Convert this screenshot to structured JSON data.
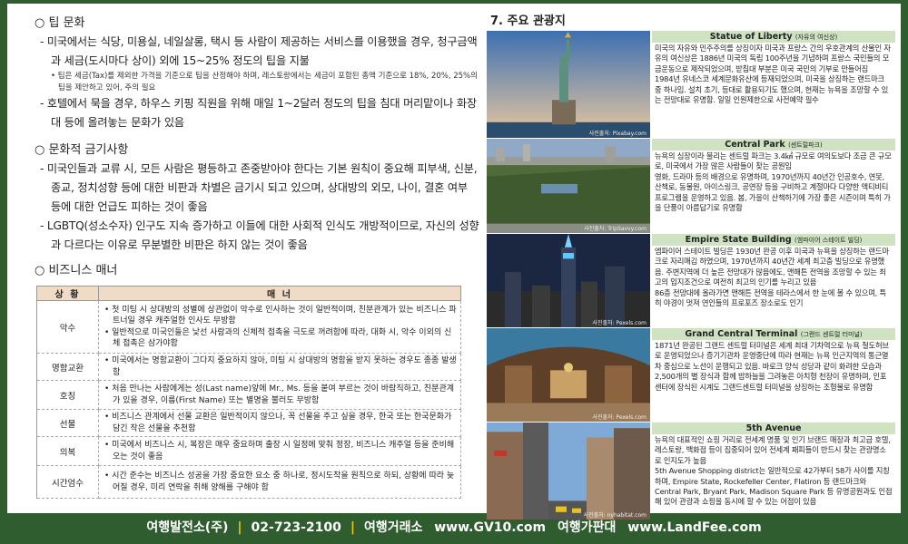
{
  "left": {
    "tip": {
      "heading": "○ 팁 문화",
      "p1": "- 미국에서는 식당, 미용실, 네일살롱, 택시 등 사람이 제공하는 서비스를 이용했을 경우, 청구금액과 세금(도시마다 상이) 외에 15~25% 정도의 팁을 지불",
      "note": "• 팁은 세금(Tax)를 제외한 가격을 기준으로 팁을 산정해야 하며, 레스토랑에서는 세금이 포함된 총액 기준으로 18%, 20%, 25%의 팁을 제안하고 있어, 주의 필요",
      "p2": "- 호텔에서 묵을 경우, 하우스 키핑 직원을 위해 매일 1~2달러 정도의 팁을 침대 머리맡이나 화장대 등에 올려놓는 문화가 있음"
    },
    "taboo": {
      "heading": "○ 문화적 금기사항",
      "p1": "- 미국인들과 교류 시, 모든 사람은 평등하고 존중받아야 한다는 기본 원칙이 중요해 피부색, 신분, 종교, 정치성향 등에 대한 비판과 차별은 금기시 되고 있으며, 상대방의 외모, 나이, 결혼 여부 등에 대한 언급도 피하는 것이 좋음",
      "p2": "- LGBTQ(성소수자) 인구도 지속 증가하고 이들에 대한 사회적 인식도 개방적이므로, 자신의 성향과 다르다는 이유로 무분별한 비판은 하지 않는 것이 좋음"
    },
    "manner": {
      "heading": "○ 비즈니스 매너",
      "col1": "상 황",
      "col2": "매 너",
      "rows": [
        {
          "cat": "악수",
          "items": [
            "첫 미팅 시 상대방의 성별에 상관없이 악수로 인사하는 것이 일반적이며, 친분관계가 있는 비즈니스 파트너일 경우 캐주얼한 인사도 무방함",
            "일반적으로 미국인들은 낯선 사람과의 신체적 접촉을 극도로 꺼려함에 따라, 대화 시, 악수 이외의 신체 접촉은 삼가야함"
          ]
        },
        {
          "cat": "명함교환",
          "items": [
            "미국에서는 명함교환이 그다지 중요하지 않아, 미팅 시 상대방의 명함을 받지 못하는 경우도 종종 발생함"
          ]
        },
        {
          "cat": "호칭",
          "items": [
            "처음 만나는 사람에게는 성(Last name)앞에 Mr., Ms. 등을 붙여 부르는 것이 바람직하고, 친분관계가 있을 경우, 이름(First Name) 또는 별명을 불러도 무방함"
          ]
        },
        {
          "cat": "선물",
          "items": [
            "비즈니스 관계에서 선물 교환은 일반적이지 않으나, 꼭 선물을 주고 싶을 경우, 한국 또는 한국문화가 담긴 작은 선물을 추천함"
          ]
        },
        {
          "cat": "의복",
          "items": [
            "미국에서 비즈니스 시, 복장은 매우 중요하며 출장 시 일정에 맞춰 정장, 비즈니스 캐주얼 등을 준비해오는 것이 좋음"
          ]
        },
        {
          "cat": "시간엄수",
          "items": [
            "시간 준수는 비즈니스 성공을 가장 중요한 요소 중 하나로, 정시도착을 원칙으로 하되, 상황에 따라 늦어질 경우, 미리 연락을 취해 양해를 구해야 함"
          ]
        }
      ]
    }
  },
  "right": {
    "title": "7. 주요 관광지",
    "attractions": [
      {
        "name": "Statue of Liberty",
        "kr": "(자유의 여신상)",
        "credit": "사진출처: Pixabay.com",
        "paras": [
          "미국의 자유와 민주주의를 상징이자 미국과 프랑스 간의 우호관계의 산물인 자유의 여신상은 1886년 미국의 독립 100주년을 기념하며 프랑스 국민들의 모금운동으로 제작되었으며, 받침대 부분은 미국 국민의 기부로 만들어짐",
          "1984년 유네스코 세계문화유산에 등재되었으며, 미국을 상징하는 랜드마크 중 하나임. 설치 초기, 등대로 활용되기도 했으며, 현재는 뉴욕을 조망할 수 있는 전망대로 유명함. 일일 인원제한으로 사전예약 필수"
        ]
      },
      {
        "name": "Central Park",
        "kr": "(센트럴파크)",
        "credit": "사진출처: TripSavvy.com",
        "paras": [
          "뉴욕의 심장이라 불리는 센트럴 파크는 3.4㎢ 규모로 여의도보다 조금 큰 규모로, 미국에서 가장 많은 사람들이 찾는 공원임",
          "영화, 드라마 등의 배경으로 유명하며, 1970년까지 40년간 인공호수, 연못, 산책로, 동물원, 아이스링크, 공연장 등을 구비하고 계절마다 다양한 액티비티 프로그램을 운영하고 있음. 봄, 가을이 산책하기에 가장 좋은 시즌이며 특히 가을 단풍이 아름답기로 유명함"
        ]
      },
      {
        "name": "Empire State Building",
        "kr": "(엠파이어 스테이트 빌딩)",
        "credit": "사진출처: Pexels.com",
        "paras": [
          "엠파이어 스테이트 빌딩은 1930년 완공 이후 미국과 뉴욕을 상징하는 랜드마크로 자리매김 하였으며, 1970년까지 40년간 세계 최고층 빌딩으로 유명했음. 주변지역에 더 높은 전망대가 많음에도, 맨해튼 전역을 조망할 수 있는 최고의 입지조건으로 여전히 최고의 인기를 누리고 있음",
          "86층 전망대에 올라가면 맨해튼 전역을 테라스에서 한 눈에 볼 수 있으며, 특히 야경이 멋져 연인들의 프로포즈 장소로도 인기"
        ]
      },
      {
        "name": "Grand Central Terminal",
        "kr": "(그랜드 센트럴 터미널)",
        "credit": "사진출처: Pexels.com",
        "paras": [
          "1871년 완공된 그랜드 센트럴 터미널은 세계 최대 기차역으로 뉴욕 철도허브로 운영되었으나 증기기관차 운영중단에 따라 현재는 뉴욕 인근지역의 통근열차 중심으로 노선이 운행되고 있음. 바로크 양식 성당과 같이 화려한 모습과 2,500개의 별 장식과 함께 밤하늘을 그려놓은 아치형 천장이 유명하며, 인포센터에 장식된 시계도 그랜드센트럴 터미널을 상징하는 조형물로 유명함"
        ]
      },
      {
        "name": "5th Avenue",
        "kr": "",
        "credit": "사진출처: nyhabitat.com",
        "paras": [
          "뉴욕의 대표적인 쇼핑 거리로 전세계 명품 및 인기 브랜드 매장과 최고급 호텔, 레스토랑, 백화점 등이 집중되어 있어 전세계 패피들이 반드시 찾는 관광명소로 인지도가 높음",
          "5th Avenue Shopping district는 일반적으로 42가부터 58가 사이를 지칭하며, Empire State, Rockefeller Center, Flatiron 등 랜드마크와 Central Park, Bryant Park, Madison Square Park 등 유명공원과도 인접해 있어 관광과 쇼핑을 동시에 할 수 있는 어점이 있음"
        ]
      }
    ]
  },
  "footer": {
    "company": "여행발전소(주)",
    "phone": "02-723-2100",
    "name1": "여행거래소",
    "url1": "www.GV10.com",
    "name2": "여행가판대",
    "url2": "www.LandFee.com",
    "separator": "|"
  },
  "colors": {
    "frame": "#2f5d2f",
    "table_header": "#f0dcc6",
    "info_header": "#cfe3c2",
    "footer_sep": "#f1c40f"
  }
}
